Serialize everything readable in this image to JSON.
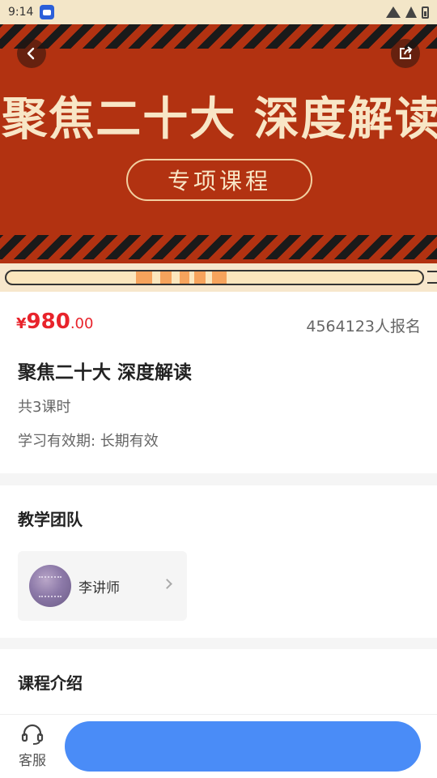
{
  "status_bar": {
    "time": "9:14"
  },
  "banner": {
    "title": "聚焦二十大 深度解读",
    "pill_label": "专项课程"
  },
  "course": {
    "price_symbol": "¥",
    "price_integer": "980",
    "price_decimal": ".00",
    "enroll_count": "4564123人报名",
    "title": "聚焦二十大 深度解读",
    "lessons": "共3课时",
    "validity": "学习有效期: 长期有效"
  },
  "team": {
    "section_title": "教学团队",
    "teacher_name": "李讲师"
  },
  "intro": {
    "section_title": "课程介绍"
  },
  "bottom": {
    "service_label": "客服",
    "buy_label": ""
  },
  "colors": {
    "banner_red": "#b23211",
    "price_red": "#e8232b",
    "button_blue": "#4a8cf7"
  }
}
